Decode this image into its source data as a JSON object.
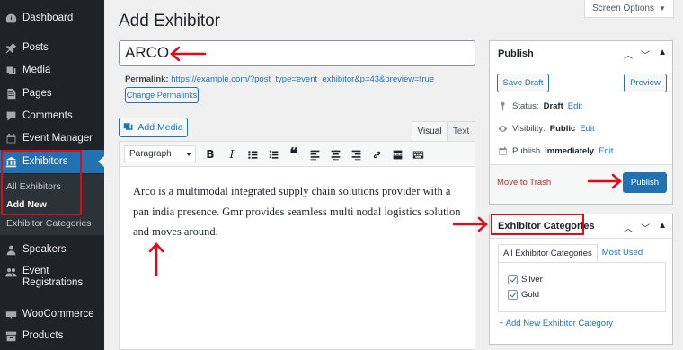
{
  "sidebar": {
    "items": [
      {
        "label": "Dashboard",
        "icon": "dashboard-icon"
      },
      {
        "label": "Posts",
        "icon": "pin-icon"
      },
      {
        "label": "Media",
        "icon": "media-icon"
      },
      {
        "label": "Pages",
        "icon": "page-icon"
      },
      {
        "label": "Comments",
        "icon": "comment-icon"
      },
      {
        "label": "Event Manager",
        "icon": "calendar-icon"
      },
      {
        "label": "Exhibitors",
        "icon": "bank-icon"
      },
      {
        "label": "Speakers",
        "icon": "speaker-icon"
      },
      {
        "label": "Event Registrations",
        "icon": "people-icon"
      },
      {
        "label": "WooCommerce",
        "icon": "woo-icon"
      },
      {
        "label": "Products",
        "icon": "archive-icon"
      }
    ],
    "submenu": [
      "All Exhibitors",
      "Add New",
      "Exhibitor Categories"
    ]
  },
  "header": {
    "title": "Add Exhibitor",
    "screen_options": "Screen Options"
  },
  "post": {
    "title": "ARCO",
    "permalink_label": "Permalink:",
    "permalink_url": "https://example.com/?post_type=event_exhibitor&p=43&preview=true",
    "change_permalinks": "Change Permalinks"
  },
  "editor": {
    "add_media": "Add Media",
    "tab_visual": "Visual",
    "tab_text": "Text",
    "format": "Paragraph",
    "content": "Arco is a multimodal integrated supply chain solutions provider with a pan india presence. Gmr provides seamless multi nodal logistics solution and moves around."
  },
  "publish": {
    "title": "Publish",
    "save_draft": "Save Draft",
    "preview": "Preview",
    "status_label": "Status:",
    "status_value": "Draft",
    "visibility_label": "Visibility:",
    "visibility_value": "Public",
    "schedule_label": "Publish",
    "schedule_value": "immediately",
    "edit": "Edit",
    "trash": "Move to Trash",
    "publish_button": "Publish"
  },
  "categories": {
    "title": "Exhibitor Categories",
    "tab_all": "All Exhibitor Categories",
    "tab_most_used": "Most Used",
    "items": [
      {
        "label": "Silver",
        "checked": true
      },
      {
        "label": "Gold",
        "checked": true
      }
    ],
    "add_new": "+ Add New Exhibitor Category"
  },
  "colors": {
    "sidebar_bg": "#1d2327",
    "accent": "#2271b1",
    "annotation": "#e30a17"
  }
}
